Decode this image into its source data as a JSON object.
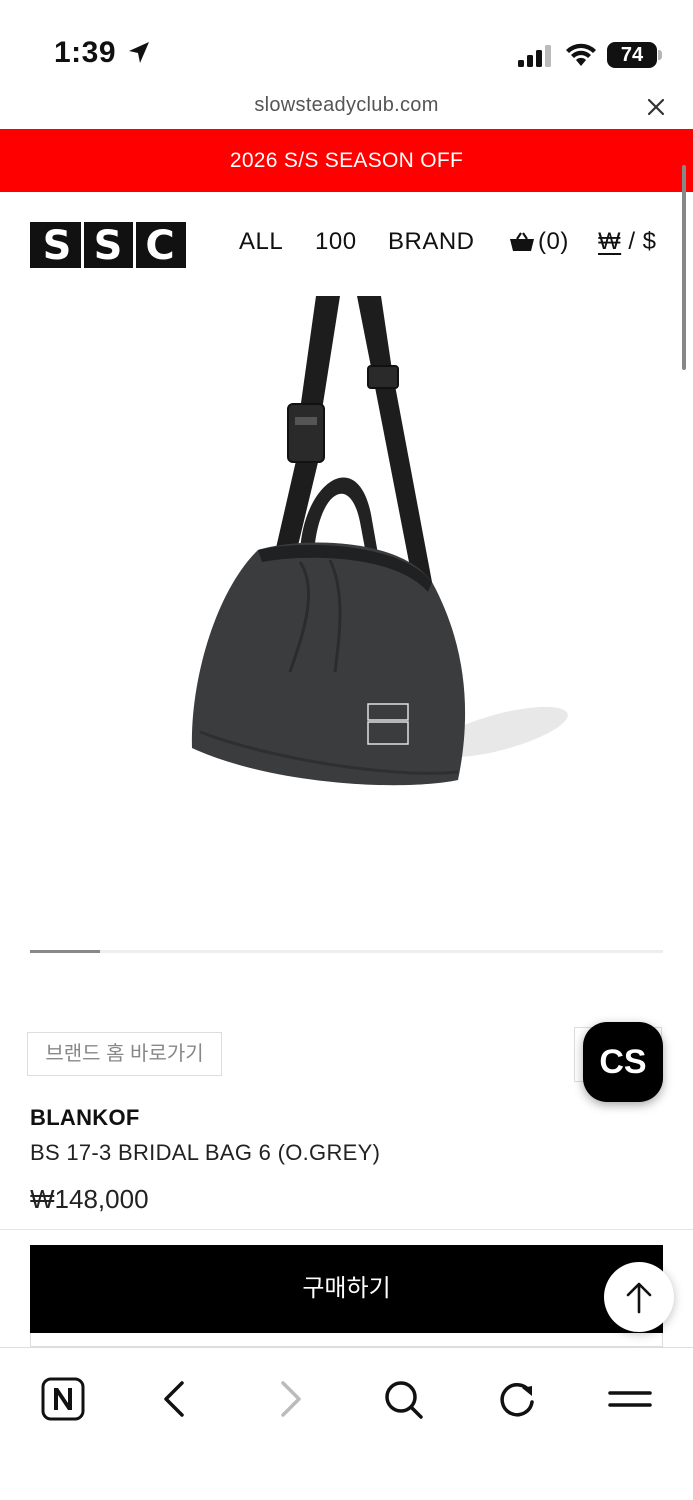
{
  "status_bar": {
    "time": "1:39",
    "battery": "74"
  },
  "browser": {
    "url": "slowsteadyclub.com"
  },
  "promo": {
    "text": "2026 S/S SEASON OFF",
    "color": "#fe0000"
  },
  "header": {
    "logo_letters": [
      "S",
      "S",
      "C"
    ],
    "nav": [
      {
        "label": "ALL"
      },
      {
        "label": "100"
      },
      {
        "label": "BRAND"
      }
    ],
    "cart_count": "(0)",
    "currency_won": "₩",
    "currency_sep": " / ",
    "currency_usd": "$"
  },
  "product": {
    "brand_link_label": "브랜드 홈 바로가기",
    "brand": "BLANKOF",
    "name": "BS 17-3 BRIDAL BAG 6 (O.GREY)",
    "price": "₩148,000",
    "buy_label": "구매하기",
    "image_slider_position": 0.11
  },
  "floating": {
    "cs_label": "CS"
  },
  "toolbar": {
    "icons": [
      "naver-icon",
      "back-icon",
      "forward-icon",
      "search-icon",
      "refresh-icon",
      "menu-icon"
    ]
  }
}
